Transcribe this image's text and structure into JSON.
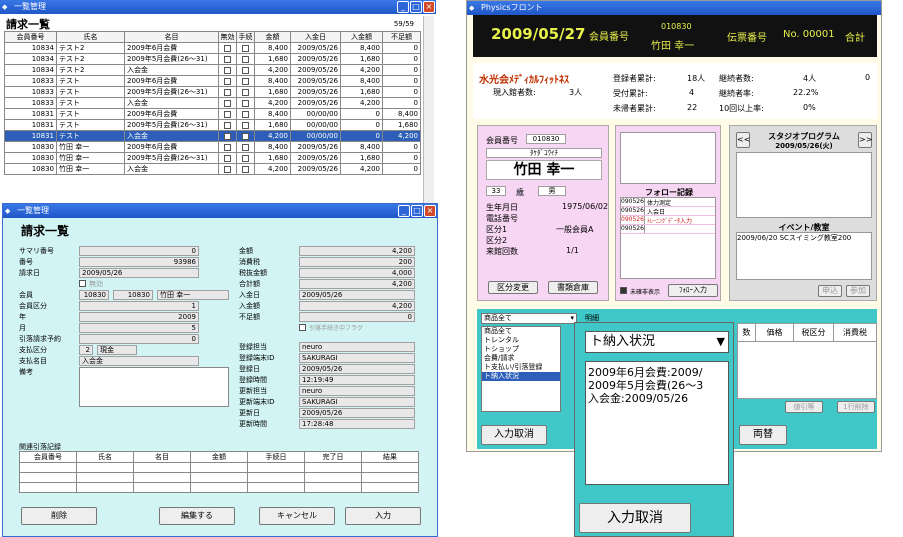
{
  "listwin": {
    "title": "一覧管理",
    "heading": "請求一覧",
    "count": "59/59",
    "cols": [
      "会員番号",
      "氏名",
      "名目",
      "無効",
      "手続",
      "金額",
      "入金日",
      "入金額",
      "不足額"
    ],
    "rows": [
      [
        "10834",
        "テスト2",
        "2009年6月会費",
        "",
        "",
        "8,400",
        "2009/05/26",
        "8,400",
        "0"
      ],
      [
        "10834",
        "テスト2",
        "2009年5月会費(26〜31)",
        "",
        "",
        "1,680",
        "2009/05/26",
        "1,680",
        "0"
      ],
      [
        "10834",
        "テスト2",
        "入会金",
        "",
        "",
        "4,200",
        "2009/05/26",
        "4,200",
        "0"
      ],
      [
        "10833",
        "テスト",
        "2009年6月会費",
        "",
        "",
        "8,400",
        "2009/05/26",
        "8,400",
        "0"
      ],
      [
        "10833",
        "テスト",
        "2009年5月会費(26〜31)",
        "",
        "",
        "1,680",
        "2009/05/26",
        "1,680",
        "0"
      ],
      [
        "10833",
        "テスト",
        "入会金",
        "",
        "",
        "4,200",
        "2009/05/26",
        "4,200",
        "0"
      ],
      [
        "10831",
        "テスト",
        "2009年6月会費",
        "",
        "",
        "8,400",
        "00/00/00",
        "0",
        "8,400"
      ],
      [
        "10831",
        "テスト",
        "2009年5月会費(26〜31)",
        "",
        "",
        "1,680",
        "00/00/00",
        "0",
        "1,680"
      ],
      [
        "10831",
        "テスト",
        "入会金",
        "",
        "",
        "4,200",
        "00/00/00",
        "0",
        "4,200"
      ],
      [
        "10830",
        "竹田 幸一",
        "2009年6月会費",
        "",
        "",
        "8,400",
        "2009/05/26",
        "8,400",
        "0"
      ],
      [
        "10830",
        "竹田 幸一",
        "2009年5月会費(26〜31)",
        "",
        "",
        "1,680",
        "2009/05/26",
        "1,680",
        "0"
      ],
      [
        "10830",
        "竹田 幸一",
        "入会金",
        "",
        "",
        "4,200",
        "2009/05/26",
        "4,200",
        "0"
      ]
    ],
    "selected_row": 8
  },
  "detail": {
    "title": "一覧管理",
    "heading": "請求一覧",
    "left": [
      {
        "label": "サマリ番号",
        "value": "0"
      },
      {
        "label": "番号",
        "value": "93986"
      },
      {
        "label": "請求日",
        "value": "2009/05/26"
      },
      {
        "label": "",
        "value": "無効"
      },
      {
        "label": "会員",
        "value": "10830",
        "value2": "10830",
        "value3": "竹田 幸一"
      },
      {
        "label": "会員区分",
        "value": "1"
      },
      {
        "label": "年",
        "value": "2009"
      },
      {
        "label": "月",
        "value": "5"
      },
      {
        "label": "引落請求予約",
        "value": "0"
      },
      {
        "label": "支払区分",
        "value": "2",
        "value2": "現金"
      },
      {
        "label": "支払名目",
        "value": "入会金"
      },
      {
        "label": "備考",
        "value": ""
      }
    ],
    "right": [
      {
        "label": "金額",
        "value": "4,200"
      },
      {
        "label": "消費税",
        "value": "200"
      },
      {
        "label": "税抜金額",
        "value": "4,000"
      },
      {
        "label": "合計額",
        "value": "4,200"
      },
      {
        "label": "入金日",
        "value": "2009/05/26"
      },
      {
        "label": "入金額",
        "value": "4,200"
      },
      {
        "label": "不足額",
        "value": "0"
      },
      {
        "label": "",
        "value": "引落手続き中フラグ"
      },
      {
        "label": "登録担当",
        "value": "neuro"
      },
      {
        "label": "登録端末ID",
        "value": "SAKURAGI"
      },
      {
        "label": "登録日",
        "value": "2009/05/26"
      },
      {
        "label": "登録時間",
        "value": "12:19:49"
      },
      {
        "label": "更新担当",
        "value": "neuro"
      },
      {
        "label": "更新端末ID",
        "value": "SAKURAGI"
      },
      {
        "label": "更新日",
        "value": "2009/05/26"
      },
      {
        "label": "更新時間",
        "value": "17:28:48"
      }
    ],
    "sub_label": "関連引落記録",
    "sub_cols": [
      "会員番号",
      "氏名",
      "名目",
      "金額",
      "手続日",
      "完了日",
      "結果"
    ],
    "buttons": [
      "削除",
      "編集する",
      "キャンセル",
      "入力"
    ]
  },
  "front": {
    "title": "Physicsフロント",
    "date": "2009/05/27",
    "member_label": "会員番号",
    "member_no": "010830",
    "member_name": "竹田 幸一",
    "slip_label": "伝票番号",
    "slip_no": "No. 00001",
    "total_label": "合計",
    "club": "水光会ﾒﾃﾞｨｶﾙﾌｨｯﾄﾈｽ",
    "stats": [
      [
        "現入館者数:",
        "3人"
      ],
      [
        "登録者累計:",
        "18人"
      ],
      [
        "受付累計:",
        "4"
      ],
      [
        "未帰者累計:",
        "22"
      ],
      [
        "継続者数:",
        "4人"
      ],
      [
        "継続者率:",
        "22.2%"
      ],
      [
        "10回以上率:",
        "0%"
      ]
    ],
    "stat_zero": "0",
    "card": {
      "no_label": "会員番号",
      "no": "010830",
      "kana": "ﾀｹﾀﾞｺｳｲﾁ",
      "name": "竹田 幸一",
      "age": "33",
      "age_unit": "歳",
      "sex": "男",
      "birth_label": "生年月日",
      "birth": "1975/06/02",
      "tel_label": "電話番号",
      "k1_label": "区分1",
      "k1": "一般会員A",
      "k2_label": "区分2",
      "visits_label": "来館回数",
      "visits": "1/1"
    },
    "btn_change": "区分変更",
    "btn_doc": "書類倉庫",
    "follow_title": "フォロー記録",
    "follow": [
      [
        "090526",
        "体力測定"
      ],
      [
        "090526",
        "入会日"
      ],
      [
        "090526",
        "ﾄﾚｰﾆﾝｸﾞﾃﾞｰﾀ入力"
      ],
      [
        "090526",
        ""
      ]
    ],
    "follow_chk": "未確非表示",
    "follow_btn": "ﾌｫﾛｰ入力",
    "studio_title": "スタジオプログラム",
    "studio_date": "2009/05/26(火)",
    "prev": "<<",
    "next": ">>",
    "event_title": "イベント/教室",
    "event": "2009/06/20 SCスイミング教室200",
    "btn_apply": "申込",
    "btn_join": "参加",
    "item_select": "商品全て",
    "item_list": [
      "商品全て",
      "トレンタル",
      "トショップ",
      "会費/請求",
      "ト支払い/引落登録",
      "ト納入状況"
    ],
    "meisai": "明細",
    "detail_cols": [
      "数",
      "価格",
      "税区分",
      "消費税"
    ],
    "btn_del1": "値引等",
    "btn_delrow": "1行削除",
    "btn_cancel": "入力取消",
    "btn_exchange": "両替",
    "popup": {
      "select": "ト納入状況",
      "lines": [
        "2009年6月会費:2009/",
        "2009年5月会費(26〜3",
        "入会金:2009/05/26"
      ],
      "button": "入力取消"
    }
  }
}
